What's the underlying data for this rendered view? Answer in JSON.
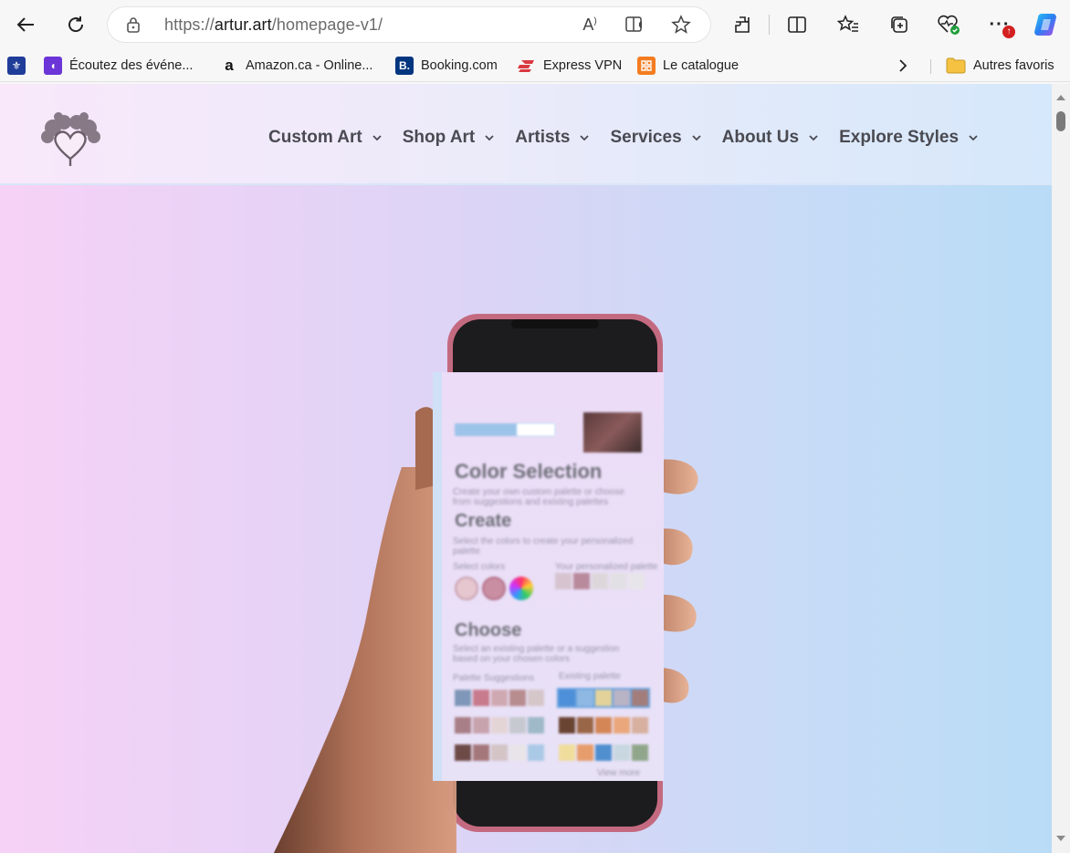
{
  "browser": {
    "url_prefix": "https://",
    "url_domain": "artur.art",
    "url_path": "/homepage-v1/",
    "icons": [
      "back-icon",
      "refresh-icon",
      "lock-icon",
      "read-aloud-icon",
      "immersive-reader-icon",
      "favorite-star-icon",
      "extensions-icon",
      "split-screen-icon",
      "favorites-icon",
      "collections-icon",
      "browser-essentials-icon",
      "more-icon",
      "copilot-icon"
    ],
    "notification_badge": "↑"
  },
  "bookmarks": [
    {
      "label": "",
      "icon": "quebec-flag-icon",
      "color": "#1f3c99"
    },
    {
      "label": "Écoutez des événe...",
      "icon": "podcast-icon",
      "color": "#6b35d8"
    },
    {
      "label": "Amazon.ca - Online...",
      "icon": "amazon-icon",
      "color": "#111111"
    },
    {
      "label": "Booking.com",
      "icon": "booking-icon",
      "color": "#003580"
    },
    {
      "label": "Express VPN",
      "icon": "expressvpn-icon",
      "color": "#da3940"
    },
    {
      "label": "Le catalogue",
      "icon": "catalogue-icon",
      "color": "#f47c20"
    },
    {
      "label": "Autres favoris",
      "icon": "folder-icon",
      "color": "#f5c242"
    }
  ],
  "site": {
    "nav": [
      {
        "label": "Custom Art"
      },
      {
        "label": "Shop Art"
      },
      {
        "label": "Artists"
      },
      {
        "label": "Services"
      },
      {
        "label": "About Us"
      },
      {
        "label": "Explore Styles"
      }
    ],
    "hero_screen": {
      "title_1": "Color Selection",
      "text_1": "Create your own custom palette or choose from suggestions and existing palettes",
      "title_2": "Create",
      "text_2": "Select the colors to create your personalized palette",
      "label_select": "Select colors",
      "label_personalized": "Your personalized palette",
      "title_3": "Choose",
      "text_3": "Select an existing palette or a suggestion based on your chosen colors",
      "label_suggestions": "Palette Suggestions",
      "label_existing": "Existing palette",
      "label_more": "View more"
    }
  },
  "colors": {
    "accent_nav_text": "#4a4a52",
    "phone_frame": "#c46a80"
  }
}
